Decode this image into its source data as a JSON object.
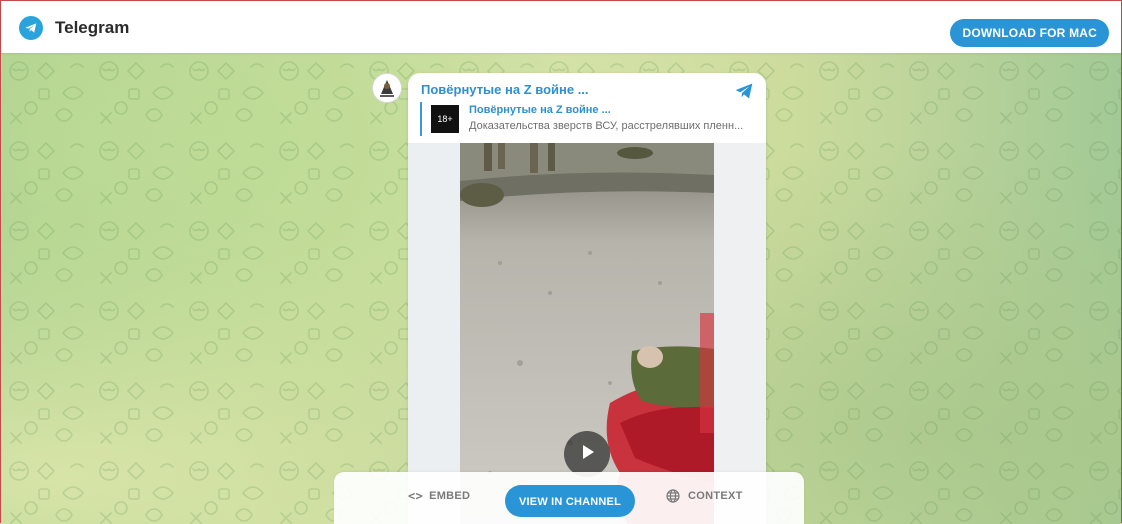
{
  "header": {
    "brand_name": "Telegram",
    "brand_icon": "telegram-logo-icon",
    "download_label": "DOWNLOAD FOR MAC"
  },
  "message": {
    "channel_title": "Повёрнутые на Z войне ...",
    "share_icon": "telegram-share-icon",
    "forward": {
      "thumb_label": "18+",
      "channel_name": "Повёрнутые на Z войне ...",
      "preview_text": "Доказательства зверств ВСУ, расстрелявших пленн..."
    },
    "video_control_icon": "play-icon"
  },
  "actions": {
    "embed_label": "EMBED",
    "embed_icon_glyph": "<>",
    "view_channel_label": "VIEW IN CHANNEL",
    "context_label": "CONTEXT",
    "context_icon": "globe-icon"
  },
  "colors": {
    "accent": "#2a95d6",
    "link": "#2f8fcf",
    "header_bg": "#ffffff",
    "blood": "#d0263b"
  }
}
